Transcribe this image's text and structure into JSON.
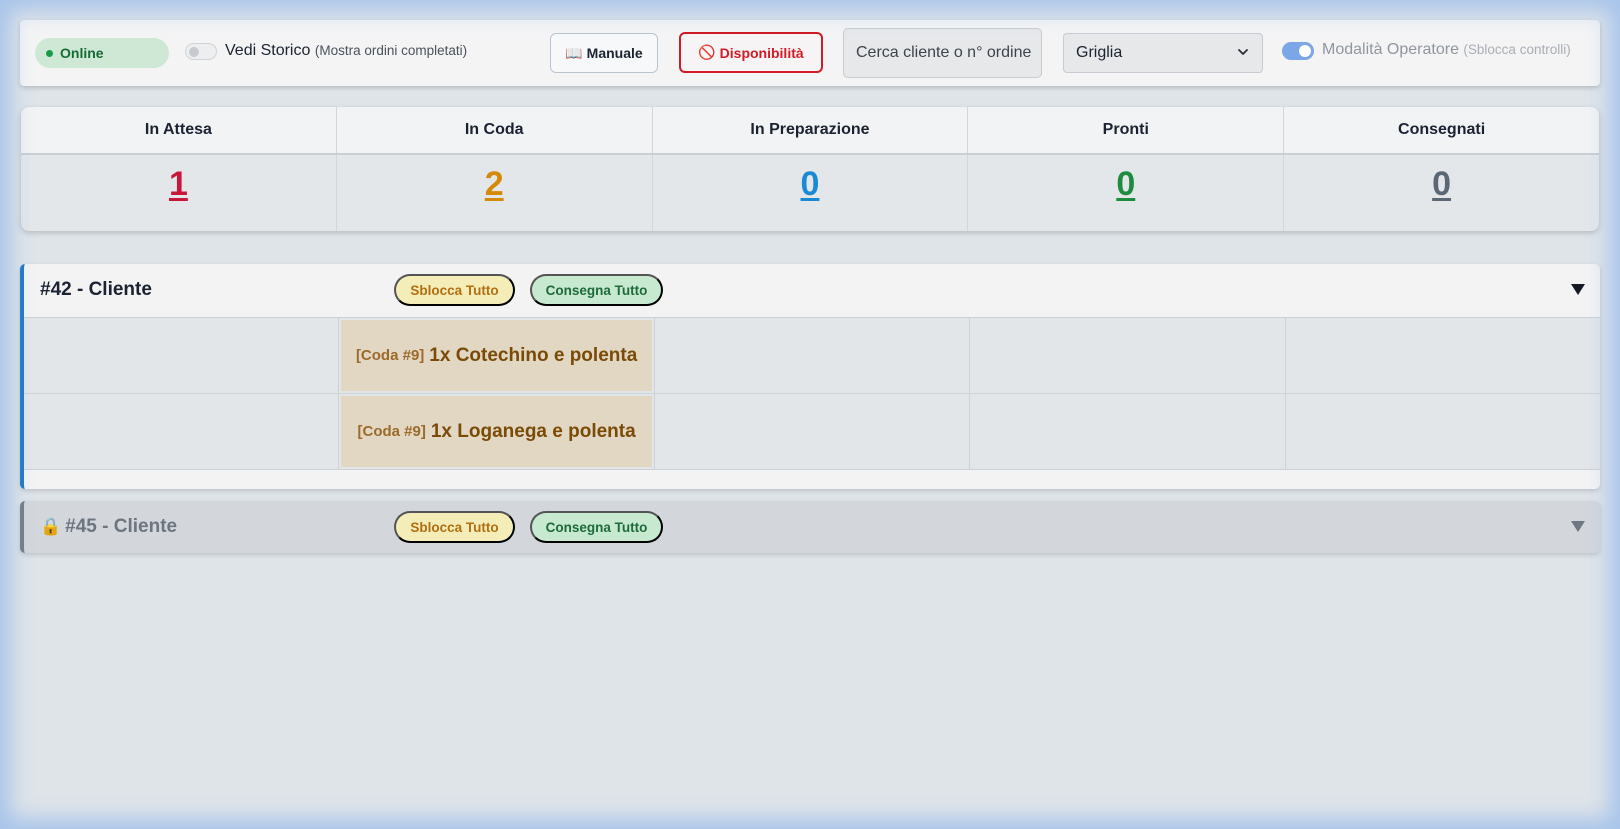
{
  "toolbar": {
    "status": "Online",
    "status_color": "#1a9a48",
    "history_label": "Vedi Storico",
    "history_sub": "(Mostra ordini completati)",
    "history_on": false,
    "manual_icon": "📖",
    "manual_label": "Manuale",
    "availability_icon": "🚫",
    "availability_label": "Disponibilità",
    "search_placeholder": "Cerca cliente o n° ordine",
    "view_select": "Griglia",
    "operator_label": "Modalità Operatore",
    "operator_sub": "(Sblocca controlli)",
    "operator_on": true
  },
  "stats": [
    {
      "label": "In Attesa",
      "value": "1",
      "color": "#c8183a"
    },
    {
      "label": "In Coda",
      "value": "2",
      "color": "#d58a07"
    },
    {
      "label": "In Preparazione",
      "value": "0",
      "color": "#1a8ad4"
    },
    {
      "label": "Pronti",
      "value": "0",
      "color": "#1d8c3d"
    },
    {
      "label": "Consegnati",
      "value": "0",
      "color": "#5c6775"
    }
  ],
  "orders": [
    {
      "title": "#42 - Cliente",
      "locked": false,
      "unlock_all": "Sblocca Tutto",
      "deliver_all": "Consegna Tutto",
      "items": [
        {
          "queue": "[Coda #9]",
          "name": "1x Cotechino e polenta"
        },
        {
          "queue": "[Coda #9]",
          "name": "1x Loganega e polenta"
        }
      ]
    },
    {
      "title": "#45 - Cliente",
      "locked": true,
      "lock_icon": "🔒",
      "unlock_all": "Sblocca Tutto",
      "deliver_all": "Consegna Tutto"
    }
  ]
}
